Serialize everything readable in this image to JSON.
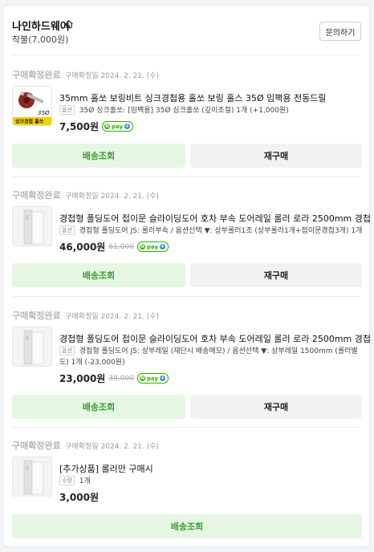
{
  "store": {
    "name": "나인하드웨어",
    "shipping": "착불(7,000원)",
    "inquire_label": "문의하기"
  },
  "colors": {
    "accent": "#3aa12f",
    "status": "#b6b6b6"
  },
  "orders": [
    {
      "status": "구매확정완료",
      "confirm_date": "구매확정일 2024. 2. 21. (수)",
      "thumb_icon": "drill-bit-image",
      "thumb_text": "35Ø",
      "thumb_banner": "싱크경첩 홀쏘",
      "title": "35mm 홀쏘 보링비트 싱크경첩용 홀쏘 보링 홀스 35Ø 임팩용 전동드릴",
      "option_badge": "옵션",
      "option_text": "35Ø 싱크홀쏘: [임팩용] 35Ø 싱크홀쏘 (깊이조절)",
      "qty": "1개 (+1,000원)",
      "price": "7,500원",
      "orig_price": "",
      "npay": "pay",
      "ship_label": "배송조회",
      "rebuy_label": "재구매"
    },
    {
      "status": "구매확정완료",
      "confirm_date": "구매확정일 2024. 2. 21. (수)",
      "thumb_icon": "door-rail-image",
      "title": "경첩형 폴딩도어 접이문 슬라이딩도어 호차 부속 도어레일 롤러 로라 2500mm 경첩",
      "option_badge": "옵션",
      "option_text": "경첩형 폴딩도어 JS: 롤러부속 / 옵션선택 ▼: 상부롤러1조 (상부롤러1개+접이문경첩3개)",
      "qty": "1개",
      "price": "46,000원",
      "orig_price": "61,000",
      "npay": "pay",
      "ship_label": "배송조회",
      "rebuy_label": "재구매"
    },
    {
      "status": "구매확정완료",
      "confirm_date": "구매확정일 2024. 2. 21. (수)",
      "thumb_icon": "door-rail-image",
      "title": "경첩형 폴딩도어 접이문 슬라이딩도어 호차 부속 도어레일 롤러 로라 2500mm 경첩",
      "option_badge": "옵션",
      "option_text": "경첩형 폴딩도어 JS: 상부레일 (재단시 배송메모) / 옵션선택 ▼: 상부레일 1500mm (롤러별도)",
      "qty": "1개 (-23,000원)",
      "price": "23,000원",
      "orig_price": "38,000",
      "npay": "pay",
      "ship_label": "배송조회",
      "rebuy_label": "재구매"
    },
    {
      "status": "구매확정완료",
      "confirm_date": "구매확정일 2024. 2. 21. (수)",
      "thumb_icon": "door-rail-image",
      "title": "[추가상품] 롤러만 구매시",
      "option_badge": "수량",
      "option_text": "1개",
      "price": "3,000원",
      "ship_label": "배송조회"
    }
  ]
}
